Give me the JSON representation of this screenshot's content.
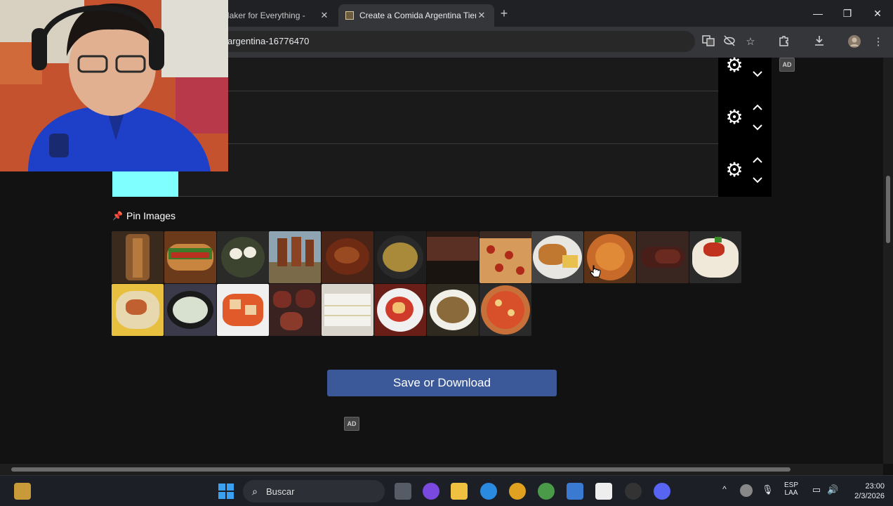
{
  "browser": {
    "tabs": [
      {
        "label": "t Maker for Everything -"
      },
      {
        "label": "Create a Comida Argentina Tier"
      }
    ],
    "address": "argentina-16776470"
  },
  "page": {
    "ad_label": "AD",
    "pin_images_label": "Pin Images",
    "save_button_label": "Save or Download",
    "food_images": [
      "asado-rotisserie",
      "choripan",
      "eggs-skillet",
      "asado-al-asador",
      "guiso",
      "locro",
      "matambre",
      "pizza-pepperoni",
      "milanesa-papas",
      "fideos-salsa",
      "morcilla",
      "noquis",
      "polenta",
      "sopa-crema",
      "ravioles",
      "asado-carne",
      "sandwiches-de-miga",
      "ravioles-tomate",
      "spaghetti",
      "pizza"
    ]
  },
  "taskbar": {
    "search_placeholder": "Buscar",
    "lang_line1": "ESP",
    "lang_line2": "LAA",
    "time": "23:00",
    "date": "2/3/2026"
  },
  "colors": {
    "accent_button": "#3b5998",
    "tier_label": "#7fffff",
    "pin": "#e0245e"
  }
}
